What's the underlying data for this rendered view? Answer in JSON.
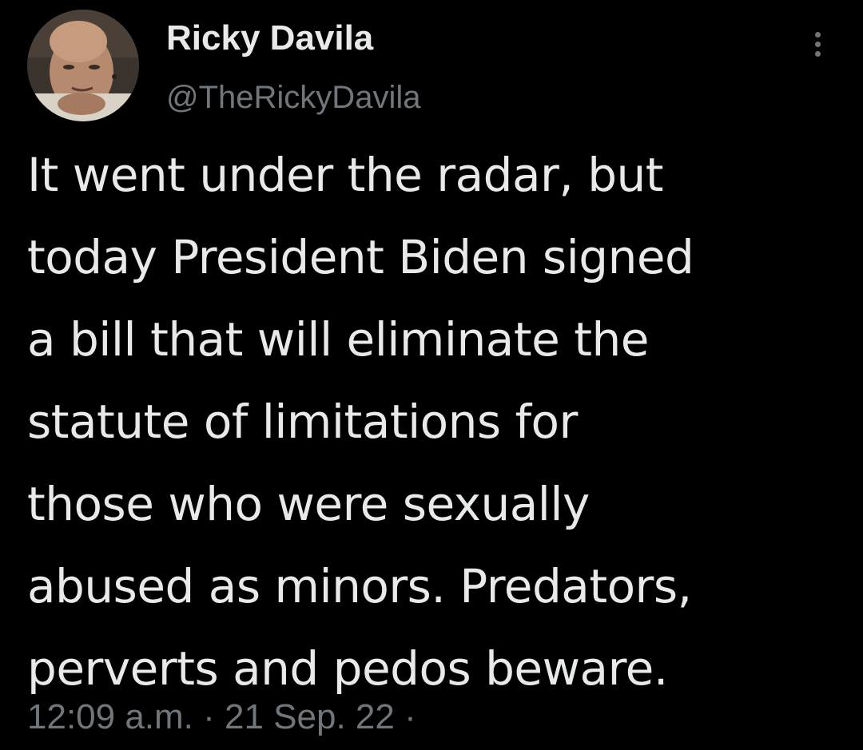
{
  "author": {
    "display_name": "Ricky Davila",
    "handle": "@TheRickyDavila"
  },
  "tweet": {
    "lines": [
      "It went under the radar, but",
      "today President Biden signed",
      "a bill that will eliminate the",
      "statute of limitations for",
      "those who were sexually",
      "abused as minors. Predators,",
      "perverts and pedos beware."
    ],
    "timestamp": "12:09 a.m. · 21 Sep. 22 ·"
  },
  "colors": {
    "background": "#000000",
    "primary_text": "#e7e9ea",
    "secondary_text": "#71767b"
  },
  "icons": {
    "more": "more-vertical-icon"
  }
}
